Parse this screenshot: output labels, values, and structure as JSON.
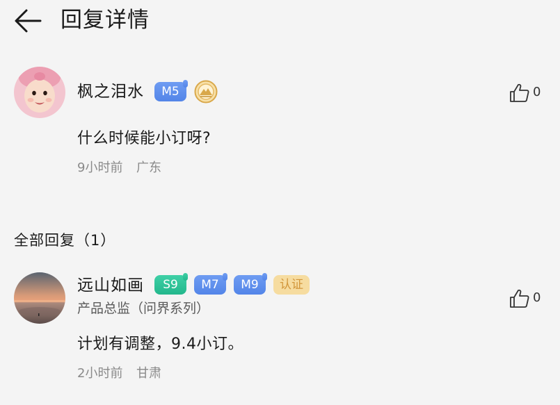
{
  "header": {
    "back_icon": "arrow-left-icon",
    "title": "回复详情"
  },
  "main_comment": {
    "avatar_icon": "baby-avatar",
    "username": "枫之泪水",
    "badges": [
      {
        "label": "M5",
        "color": "#5f90ee"
      }
    ],
    "medal_icon": "gold-mountain-medal-icon",
    "text": "什么时候能小订呀?",
    "time": "9小时前",
    "location": "广东",
    "like_icon": "thumbs-up-icon",
    "like_count": "0"
  },
  "replies_section": {
    "title": "全部回复（1）"
  },
  "replies": [
    {
      "avatar_icon": "sunset-beach-avatar",
      "username": "远山如画",
      "badges": [
        {
          "label": "S9",
          "color": "#2fc497"
        },
        {
          "label": "M7",
          "color": "#5f90ee"
        },
        {
          "label": "M9",
          "color": "#5f90ee"
        },
        {
          "label": "认证",
          "color": "#f6dca0"
        }
      ],
      "subtitle": "产品总监（问界系列）",
      "text": "计划有调整，9.4小订。",
      "time": "2小时前",
      "location": "甘肃",
      "like_icon": "thumbs-up-icon",
      "like_count": "0"
    }
  ]
}
